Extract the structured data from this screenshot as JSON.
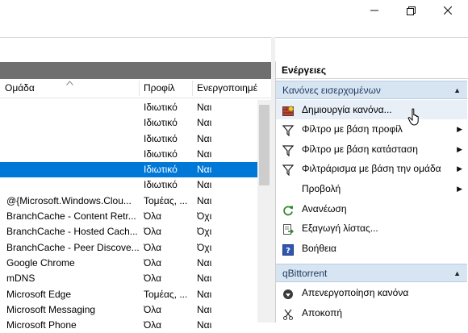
{
  "window": {
    "minimize_glyph": "—",
    "maximize_glyph": "❐",
    "close_glyph": "✕"
  },
  "grid": {
    "columns": [
      "Ομάδα",
      "Προφίλ",
      "Ενεργοποιημέ"
    ],
    "rows": [
      {
        "group": "",
        "profile": "Ιδιωτικό",
        "enabled": "Ναι",
        "selected": false
      },
      {
        "group": "",
        "profile": "Ιδιωτικό",
        "enabled": "Ναι",
        "selected": false
      },
      {
        "group": "",
        "profile": "Ιδιωτικό",
        "enabled": "Ναι",
        "selected": false
      },
      {
        "group": "",
        "profile": "Ιδιωτικό",
        "enabled": "Ναι",
        "selected": false
      },
      {
        "group": "",
        "profile": "Ιδιωτικό",
        "enabled": "Ναι",
        "selected": true
      },
      {
        "group": "",
        "profile": "Ιδιωτικό",
        "enabled": "Ναι",
        "selected": false
      },
      {
        "group": "@{Microsoft.Windows.Clou...",
        "profile": "Τομέας, ...",
        "enabled": "Ναι",
        "selected": false
      },
      {
        "group": "BranchCache - Content Retr...",
        "profile": "Όλα",
        "enabled": "Όχι",
        "selected": false
      },
      {
        "group": "BranchCache - Hosted Cach...",
        "profile": "Όλα",
        "enabled": "Όχι",
        "selected": false
      },
      {
        "group": "BranchCache - Peer Discove...",
        "profile": "Όλα",
        "enabled": "Όχι",
        "selected": false
      },
      {
        "group": "Google Chrome",
        "profile": "Όλα",
        "enabled": "Ναι",
        "selected": false
      },
      {
        "group": "mDNS",
        "profile": "Όλα",
        "enabled": "Ναι",
        "selected": false
      },
      {
        "group": "Microsoft Edge",
        "profile": "Τομέας, ...",
        "enabled": "Ναι",
        "selected": false
      },
      {
        "group": "Microsoft Messaging",
        "profile": "Όλα",
        "enabled": "Ναι",
        "selected": false
      },
      {
        "group": "Microsoft Phone",
        "profile": "Όλα",
        "enabled": "Ναι",
        "selected": false
      }
    ]
  },
  "actions": {
    "title": "Ενέργειες",
    "sections": [
      {
        "header": "Κανόνες εισερχομένων",
        "items": [
          {
            "label": "Δημιουργία κανόνα...",
            "icon": "new-rule-icon",
            "submenu": false
          },
          {
            "label": "Φίλτρο με βάση προφίλ",
            "icon": "filter-icon",
            "submenu": true
          },
          {
            "label": "Φίλτρο με βάση κατάσταση",
            "icon": "filter-icon",
            "submenu": true
          },
          {
            "label": "Φιλτράρισμα με βάση την ομάδα",
            "icon": "filter-icon",
            "submenu": true
          },
          {
            "label": "Προβολή",
            "icon": "",
            "submenu": true
          },
          {
            "label": "Ανανέωση",
            "icon": "refresh-icon",
            "submenu": false
          },
          {
            "label": "Εξαγωγή λίστας...",
            "icon": "export-list-icon",
            "submenu": false
          },
          {
            "label": "Βοήθεια",
            "icon": "help-icon",
            "submenu": false
          }
        ]
      },
      {
        "header": "qBittorrent",
        "items": [
          {
            "label": "Απενεργοποίηση κανόνα",
            "icon": "disable-rule-icon",
            "submenu": false
          },
          {
            "label": "Αποκοπή",
            "icon": "cut-icon",
            "submenu": false
          }
        ]
      }
    ]
  },
  "colors": {
    "selection": "#0078d7",
    "section_header_bg": "#d7e4f2",
    "grid_topbar": "#6f6f6f"
  }
}
